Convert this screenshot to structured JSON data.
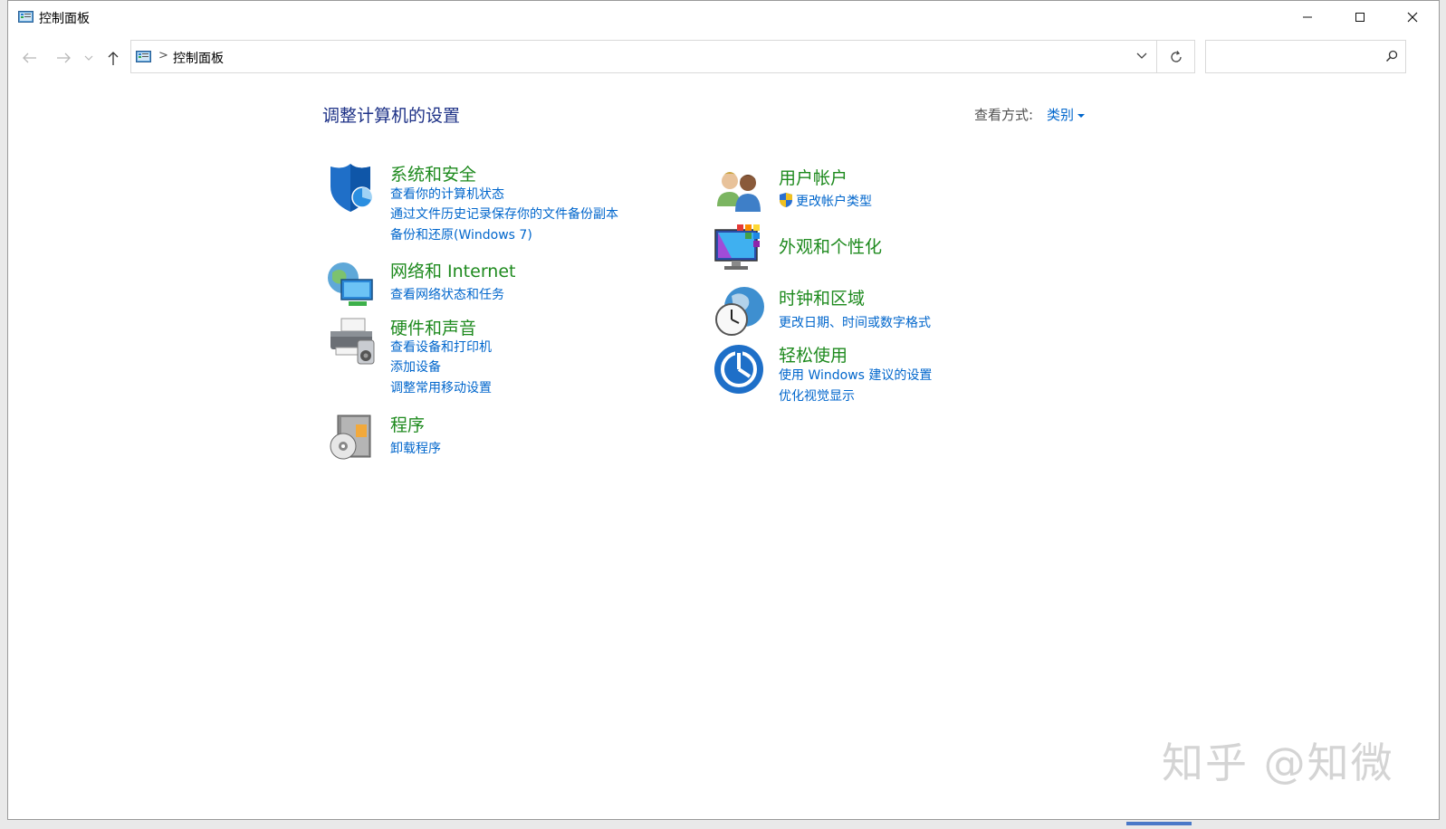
{
  "window": {
    "title": "控制面板",
    "minimize_label": "Minimize",
    "maximize_label": "Maximize",
    "close_label": "Close"
  },
  "nav": {
    "back_icon": "arrow-left-icon",
    "forward_icon": "arrow-right-icon",
    "recent_icon": "chevron-down-icon",
    "up_icon": "arrow-up-icon",
    "refresh_icon": "refresh-icon"
  },
  "address": {
    "crumb": "控制面板",
    "separator": ">"
  },
  "search": {
    "value": "",
    "placeholder": ""
  },
  "content": {
    "title": "调整计算机的设置",
    "view_by_label": "查看方式:",
    "view_by_value": "类别"
  },
  "categories": [
    {
      "title": "系统和安全",
      "icon": "shield-icon",
      "links": [
        "查看你的计算机状态",
        "通过文件历史记录保存你的文件备份副本",
        "备份和还原(Windows 7)"
      ]
    },
    {
      "title": "网络和 Internet",
      "icon": "network-icon",
      "links": [
        "查看网络状态和任务"
      ]
    },
    {
      "title": "硬件和声音",
      "icon": "printer-icon",
      "links": [
        "查看设备和打印机",
        "添加设备",
        "调整常用移动设置"
      ]
    },
    {
      "title": "程序",
      "icon": "programs-icon",
      "links": [
        "卸载程序"
      ]
    },
    {
      "title": "用户帐户",
      "icon": "users-icon",
      "links": [
        "更改帐户类型"
      ]
    },
    {
      "title": "外观和个性化",
      "icon": "monitor-icon",
      "links": []
    },
    {
      "title": "时钟和区域",
      "icon": "clock-globe-icon",
      "links": [
        "更改日期、时间或数字格式"
      ]
    },
    {
      "title": "轻松使用",
      "icon": "ease-of-access-icon",
      "links": [
        "使用 Windows 建议的设置",
        "优化视觉显示"
      ]
    }
  ],
  "watermark": "知乎 @知微",
  "colors": {
    "category_title": "#1e8a1e",
    "link": "#0066cc",
    "page_title": "#1e3287"
  }
}
